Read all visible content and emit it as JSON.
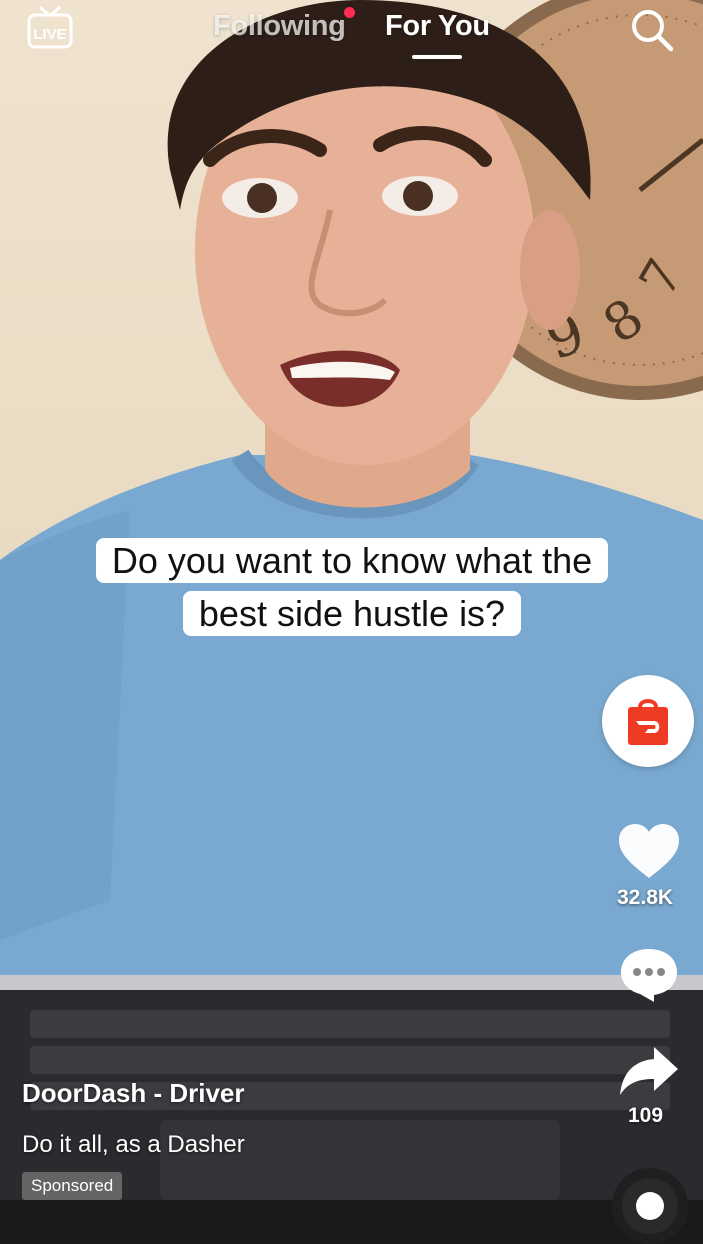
{
  "topbar": {
    "live_label": "LIVE",
    "tabs": [
      {
        "label": "Following",
        "active": false,
        "has_notification_dot": true
      },
      {
        "label": "For You",
        "active": true
      }
    ],
    "search_icon": "search-icon"
  },
  "video": {
    "caption": "Do you want to know what the best side hustle is?"
  },
  "actions": {
    "brand_icon": "doordash-bag-icon",
    "like_count": "32.8K",
    "comment_icon": "comment-icon",
    "share_count": "109"
  },
  "post": {
    "account_name": "DoorDash - Driver",
    "description": "Do it all, as a Dasher",
    "badge": "Sponsored"
  },
  "colors": {
    "accent": "#ff2b55",
    "brand": "#ef3b24",
    "text": "#ffffff"
  }
}
